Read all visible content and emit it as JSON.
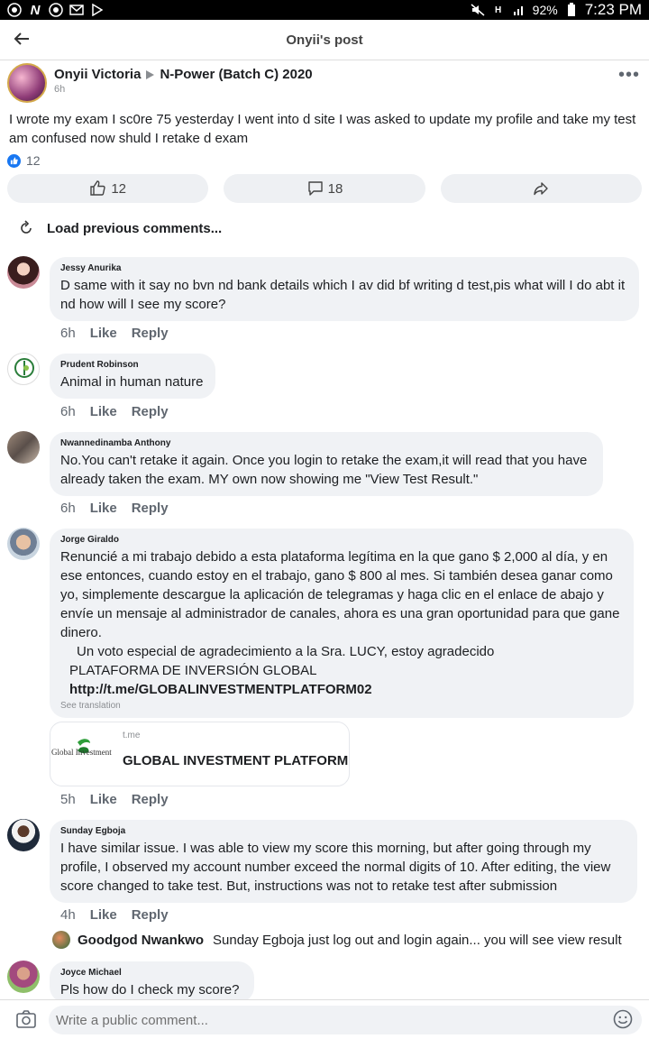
{
  "status_bar": {
    "battery": "92%",
    "time": "7:23 PM",
    "network_label": "H"
  },
  "header": {
    "title": "Onyii's post"
  },
  "post": {
    "author": "Onyii Victoria",
    "group": "N-Power (Batch C) 2020",
    "time": "6h",
    "text": "I wrote my exam I sc0re 75 yesterday I went into  d site I was asked to  update my  profile and take my test am confused now shuld I retake d exam",
    "reaction_count": "12",
    "like_count": "12",
    "comment_count": "18"
  },
  "load_previous": "Load previous comments...",
  "labels": {
    "like": "Like",
    "reply": "Reply"
  },
  "comments": [
    {
      "name": "Jessy Anurika",
      "text": "D same with it say no bvn nd bank details which I av did bf writing d test,pis what will I do abt it nd how will I see my score?",
      "time": "6h"
    },
    {
      "name": "Prudent Robinson",
      "text": "Animal in human nature",
      "time": "6h"
    },
    {
      "name": "Nwannedinamba Anthony",
      "text": "No.You can't retake it again. Once you login to retake the exam,it will read that you have already taken the exam. MY own now showing me \"View Test Result.\"",
      "time": "6h"
    },
    {
      "name": "Jorge Giraldo",
      "text": "Renuncié a mi trabajo debido a esta plataforma legítima en la que gano $ 2,000 al día, y en ese entonces, cuando estoy en el trabajo, gano $ 800 al mes.  Si también desea ganar como yo, simplemente descargue la aplicación de telegramas y haga clic en el enlace de abajo y envíe un mensaje al administrador de canales, ahora es una gran oportunidad para que gane dinero.",
      "line2": "Un voto especial de agradecimiento a la Sra. LUCY, estoy agradecido",
      "line3": "PLATAFORMA DE INVERSIÓN GLOBAL",
      "link": "http://t.me/GLOBALINVESTMENTPLATFORM02",
      "see_translation": "See translation",
      "time": "5h",
      "link_card": {
        "domain": "t.me",
        "title": "GLOBAL INVESTMENT PLATFORM",
        "logo_text": "Global Investment"
      }
    },
    {
      "name": "Sunday Egboja",
      "text": "I have similar issue. I was able to view my score this morning, but after going through my profile, I observed my account number exceed the normal digits of 10. After editing, the view score changed to take test. But, instructions was not to retake test after submission",
      "time": "4h",
      "reply": {
        "name": "Goodgod Nwankwo",
        "text": "Sunday Egboja just log out and login again... you will see view result"
      }
    },
    {
      "name": "Joyce Michael",
      "text": "Pls how do I check my score?"
    }
  ],
  "composer": {
    "placeholder": "Write a public comment..."
  },
  "colors": {
    "accent": "#1877f2",
    "bubble": "#f0f2f5",
    "meta": "#606770"
  }
}
